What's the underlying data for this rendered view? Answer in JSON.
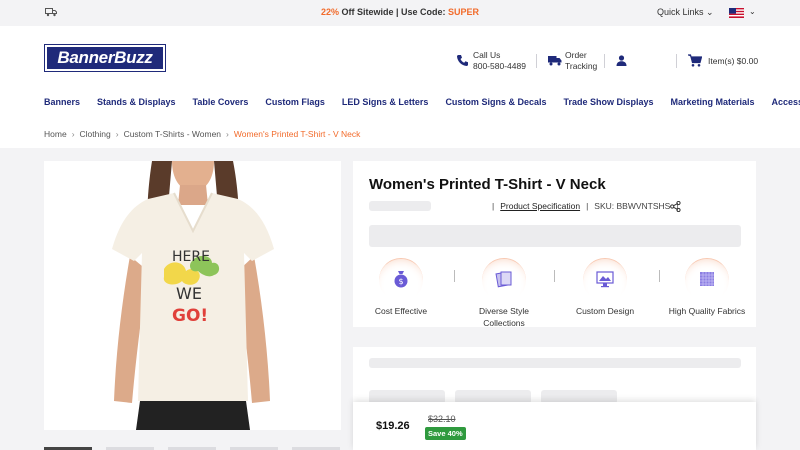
{
  "topbar": {
    "promo_percent": "22%",
    "promo_text": " Off Sitewide | Use Code: ",
    "promo_code": "SUPER",
    "quick_links": "Quick Links"
  },
  "header": {
    "logo_part1": "Banner",
    "logo_part2": "Buzz",
    "call_label": "Call Us",
    "call_number": "800-580-4489",
    "order_label1": "Order",
    "order_label2": "Tracking",
    "cart_text": "Item(s)  $0.00"
  },
  "nav": {
    "items": [
      "Banners",
      "Stands & Displays",
      "Table Covers",
      "Custom Flags",
      "LED Signs & Letters",
      "Custom Signs & Decals",
      "Trade Show Displays",
      "Marketing Materials",
      "Accessories"
    ]
  },
  "breadcrumb": {
    "items": [
      "Home",
      "Clothing",
      "Custom T-Shirts - Women"
    ],
    "current": "Women's Printed T-Shirt - V Neck"
  },
  "product": {
    "title": "Women's Printed T-Shirt - V Neck",
    "spec_link": "Product Specification",
    "sku": "SKU: BBWVNTSHS",
    "shirt_text": [
      "HERE",
      "WE",
      "GO!"
    ]
  },
  "features": [
    {
      "label": "Cost Effective",
      "icon": "money-bag-icon"
    },
    {
      "label": "Diverse Style Collections",
      "icon": "cards-icon"
    },
    {
      "label": "Custom Design",
      "icon": "monitor-design-icon"
    },
    {
      "label": "High Quality Fabrics",
      "icon": "fabric-icon"
    }
  ],
  "pricing": {
    "price": "$19.26",
    "old_price": "$32.10",
    "save": "Save 40%"
  },
  "colors": {
    "brand": "#1f2a7a",
    "accent": "#f26b2b",
    "save_green": "#2f9a3e"
  }
}
